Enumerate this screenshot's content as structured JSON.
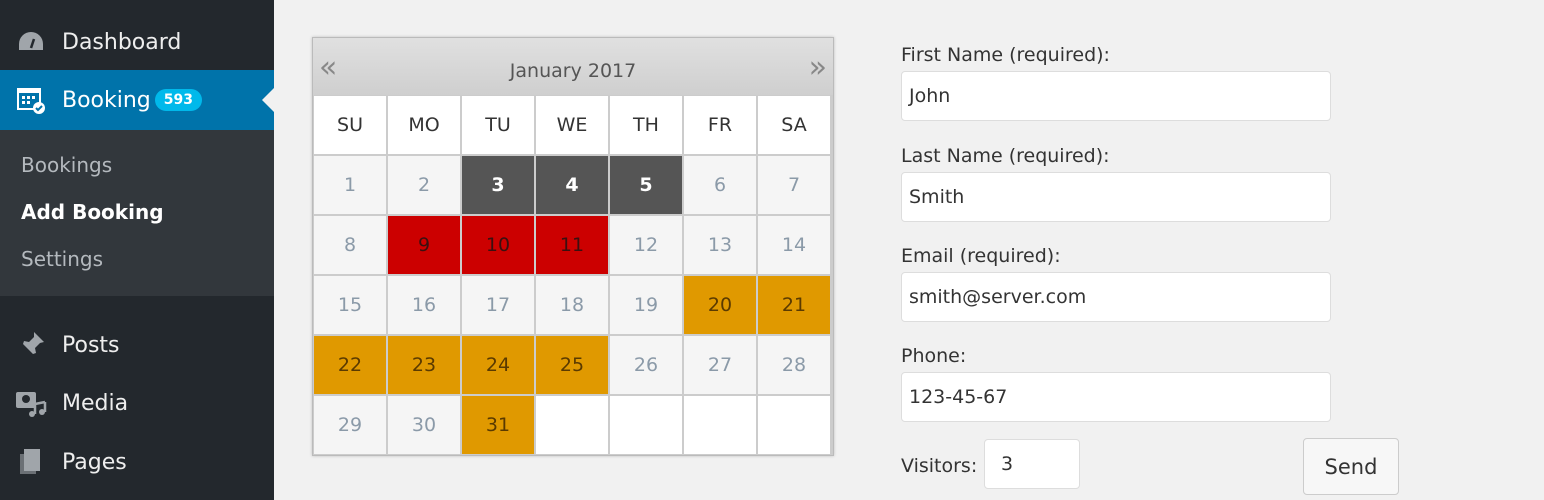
{
  "sidebar": {
    "dashboard": "Dashboard",
    "booking": "Booking",
    "booking_badge": "593",
    "sub": [
      "Bookings",
      "Add Booking",
      "Settings"
    ],
    "posts": "Posts",
    "media": "Media",
    "pages": "Pages"
  },
  "calendar": {
    "title": "January 2017",
    "prev": "«",
    "next": "»",
    "days": [
      "SU",
      "MO",
      "TU",
      "WE",
      "TH",
      "FR",
      "SA"
    ],
    "weeks": [
      [
        [
          "1",
          "available"
        ],
        [
          "2",
          "available"
        ],
        [
          "3",
          "past"
        ],
        [
          "4",
          "past"
        ],
        [
          "5",
          "past"
        ],
        [
          "6",
          "available"
        ],
        [
          "7",
          "available"
        ]
      ],
      [
        [
          "8",
          "available"
        ],
        [
          "9",
          "booked"
        ],
        [
          "10",
          "booked"
        ],
        [
          "11",
          "booked"
        ],
        [
          "12",
          "available"
        ],
        [
          "13",
          "available"
        ],
        [
          "14",
          "available"
        ]
      ],
      [
        [
          "15",
          "available"
        ],
        [
          "16",
          "available"
        ],
        [
          "17",
          "available"
        ],
        [
          "18",
          "available"
        ],
        [
          "19",
          "available"
        ],
        [
          "20",
          "pending"
        ],
        [
          "21",
          "pending"
        ]
      ],
      [
        [
          "22",
          "pending"
        ],
        [
          "23",
          "pending"
        ],
        [
          "24",
          "pending"
        ],
        [
          "25",
          "pending"
        ],
        [
          "26",
          "available"
        ],
        [
          "27",
          "available"
        ],
        [
          "28",
          "available"
        ]
      ],
      [
        [
          "29",
          "available"
        ],
        [
          "30",
          "available"
        ],
        [
          "31",
          "pending"
        ],
        [
          "",
          "empty"
        ],
        [
          "",
          "empty"
        ],
        [
          "",
          "empty"
        ],
        [
          "",
          "empty"
        ]
      ]
    ],
    "colors": {
      "past": "#555555",
      "booked": "#cc0000",
      "pending": "#e09900",
      "available": "#f5f5f5"
    }
  },
  "form": {
    "first_label": "First Name (required):",
    "first": "John",
    "last_label": "Last Name (required):",
    "last": "Smith",
    "email_label": "Email (required):",
    "email": "smith@server.com",
    "phone_label": "Phone:",
    "phone": "123-45-67",
    "visitors_label": "Visitors:",
    "visitors": "3",
    "send": "Send"
  }
}
